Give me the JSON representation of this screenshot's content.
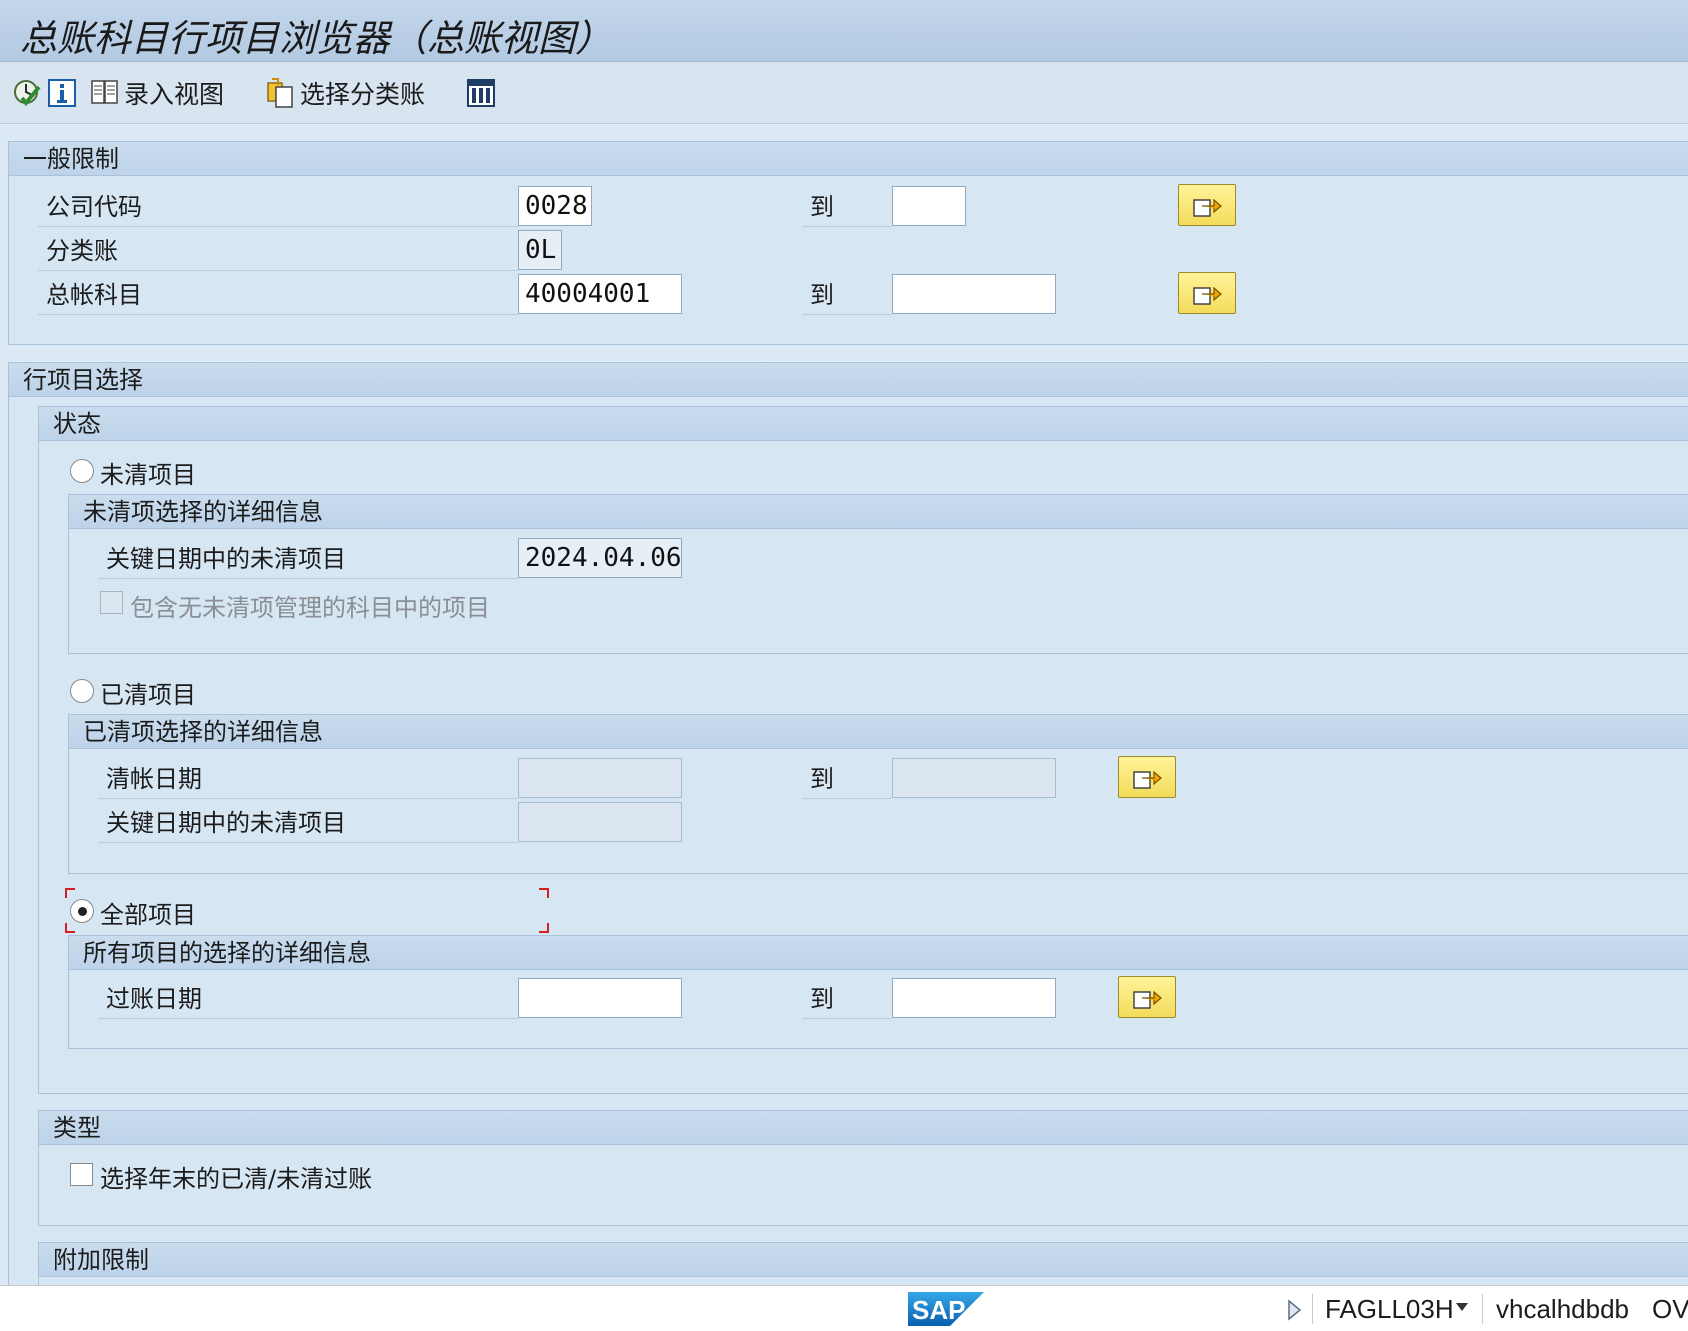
{
  "title": "总账科目行项目浏览器（总账视图）",
  "toolbar": {
    "entry_view_label": "录入视图",
    "select_ledger_label": "选择分类账"
  },
  "general": {
    "heading": "一般限制",
    "company_code_label": "公司代码",
    "company_code_value": "0028",
    "company_code_to_label": "到",
    "company_code_to_value": "",
    "ledger_label": "分类账",
    "ledger_value": "0L",
    "gl_account_label": "总帐科目",
    "gl_account_value": "40004001",
    "gl_account_to_label": "到",
    "gl_account_to_value": ""
  },
  "line_items": {
    "heading": "行项目选择",
    "status": {
      "heading": "状态",
      "open_items_label": "未清项目",
      "open_details_heading": "未清项选择的详细信息",
      "open_key_date_label": "关键日期中的未清项目",
      "open_key_date_value": "2024.04.06",
      "include_non_open_label": "包含无未清项管理的科目中的项目",
      "cleared_items_label": "已清项目",
      "cleared_details_heading": "已清项选择的详细信息",
      "clearing_date_label": "清帐日期",
      "clearing_date_to_label": "到",
      "cleared_key_date_label": "关键日期中的未清项目",
      "all_items_label": "全部项目",
      "all_details_heading": "所有项目的选择的详细信息",
      "posting_date_label": "过账日期",
      "posting_date_to_label": "到",
      "selected": "all"
    },
    "type": {
      "heading": "类型",
      "year_end_label": "选择年末的已清/未清过账"
    },
    "additional": {
      "heading": "附加限制"
    }
  },
  "statusbar": {
    "tcode": "FAGLL03H",
    "server": "vhcalhdbdb",
    "server_suffix": "OV"
  }
}
